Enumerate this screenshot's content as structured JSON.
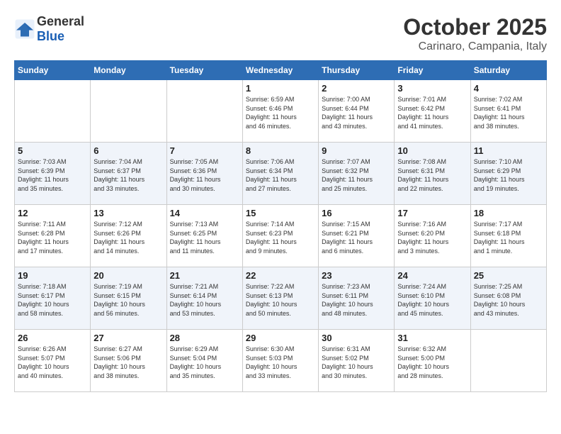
{
  "logo": {
    "general": "General",
    "blue": "Blue"
  },
  "title": "October 2025",
  "subtitle": "Carinaro, Campania, Italy",
  "weekdays": [
    "Sunday",
    "Monday",
    "Tuesday",
    "Wednesday",
    "Thursday",
    "Friday",
    "Saturday"
  ],
  "weeks": [
    [
      {
        "day": "",
        "info": ""
      },
      {
        "day": "",
        "info": ""
      },
      {
        "day": "",
        "info": ""
      },
      {
        "day": "1",
        "info": "Sunrise: 6:59 AM\nSunset: 6:46 PM\nDaylight: 11 hours\nand 46 minutes."
      },
      {
        "day": "2",
        "info": "Sunrise: 7:00 AM\nSunset: 6:44 PM\nDaylight: 11 hours\nand 43 minutes."
      },
      {
        "day": "3",
        "info": "Sunrise: 7:01 AM\nSunset: 6:42 PM\nDaylight: 11 hours\nand 41 minutes."
      },
      {
        "day": "4",
        "info": "Sunrise: 7:02 AM\nSunset: 6:41 PM\nDaylight: 11 hours\nand 38 minutes."
      }
    ],
    [
      {
        "day": "5",
        "info": "Sunrise: 7:03 AM\nSunset: 6:39 PM\nDaylight: 11 hours\nand 35 minutes."
      },
      {
        "day": "6",
        "info": "Sunrise: 7:04 AM\nSunset: 6:37 PM\nDaylight: 11 hours\nand 33 minutes."
      },
      {
        "day": "7",
        "info": "Sunrise: 7:05 AM\nSunset: 6:36 PM\nDaylight: 11 hours\nand 30 minutes."
      },
      {
        "day": "8",
        "info": "Sunrise: 7:06 AM\nSunset: 6:34 PM\nDaylight: 11 hours\nand 27 minutes."
      },
      {
        "day": "9",
        "info": "Sunrise: 7:07 AM\nSunset: 6:32 PM\nDaylight: 11 hours\nand 25 minutes."
      },
      {
        "day": "10",
        "info": "Sunrise: 7:08 AM\nSunset: 6:31 PM\nDaylight: 11 hours\nand 22 minutes."
      },
      {
        "day": "11",
        "info": "Sunrise: 7:10 AM\nSunset: 6:29 PM\nDaylight: 11 hours\nand 19 minutes."
      }
    ],
    [
      {
        "day": "12",
        "info": "Sunrise: 7:11 AM\nSunset: 6:28 PM\nDaylight: 11 hours\nand 17 minutes."
      },
      {
        "day": "13",
        "info": "Sunrise: 7:12 AM\nSunset: 6:26 PM\nDaylight: 11 hours\nand 14 minutes."
      },
      {
        "day": "14",
        "info": "Sunrise: 7:13 AM\nSunset: 6:25 PM\nDaylight: 11 hours\nand 11 minutes."
      },
      {
        "day": "15",
        "info": "Sunrise: 7:14 AM\nSunset: 6:23 PM\nDaylight: 11 hours\nand 9 minutes."
      },
      {
        "day": "16",
        "info": "Sunrise: 7:15 AM\nSunset: 6:21 PM\nDaylight: 11 hours\nand 6 minutes."
      },
      {
        "day": "17",
        "info": "Sunrise: 7:16 AM\nSunset: 6:20 PM\nDaylight: 11 hours\nand 3 minutes."
      },
      {
        "day": "18",
        "info": "Sunrise: 7:17 AM\nSunset: 6:18 PM\nDaylight: 11 hours\nand 1 minute."
      }
    ],
    [
      {
        "day": "19",
        "info": "Sunrise: 7:18 AM\nSunset: 6:17 PM\nDaylight: 10 hours\nand 58 minutes."
      },
      {
        "day": "20",
        "info": "Sunrise: 7:19 AM\nSunset: 6:15 PM\nDaylight: 10 hours\nand 56 minutes."
      },
      {
        "day": "21",
        "info": "Sunrise: 7:21 AM\nSunset: 6:14 PM\nDaylight: 10 hours\nand 53 minutes."
      },
      {
        "day": "22",
        "info": "Sunrise: 7:22 AM\nSunset: 6:13 PM\nDaylight: 10 hours\nand 50 minutes."
      },
      {
        "day": "23",
        "info": "Sunrise: 7:23 AM\nSunset: 6:11 PM\nDaylight: 10 hours\nand 48 minutes."
      },
      {
        "day": "24",
        "info": "Sunrise: 7:24 AM\nSunset: 6:10 PM\nDaylight: 10 hours\nand 45 minutes."
      },
      {
        "day": "25",
        "info": "Sunrise: 7:25 AM\nSunset: 6:08 PM\nDaylight: 10 hours\nand 43 minutes."
      }
    ],
    [
      {
        "day": "26",
        "info": "Sunrise: 6:26 AM\nSunset: 5:07 PM\nDaylight: 10 hours\nand 40 minutes."
      },
      {
        "day": "27",
        "info": "Sunrise: 6:27 AM\nSunset: 5:06 PM\nDaylight: 10 hours\nand 38 minutes."
      },
      {
        "day": "28",
        "info": "Sunrise: 6:29 AM\nSunset: 5:04 PM\nDaylight: 10 hours\nand 35 minutes."
      },
      {
        "day": "29",
        "info": "Sunrise: 6:30 AM\nSunset: 5:03 PM\nDaylight: 10 hours\nand 33 minutes."
      },
      {
        "day": "30",
        "info": "Sunrise: 6:31 AM\nSunset: 5:02 PM\nDaylight: 10 hours\nand 30 minutes."
      },
      {
        "day": "31",
        "info": "Sunrise: 6:32 AM\nSunset: 5:00 PM\nDaylight: 10 hours\nand 28 minutes."
      },
      {
        "day": "",
        "info": ""
      }
    ]
  ]
}
